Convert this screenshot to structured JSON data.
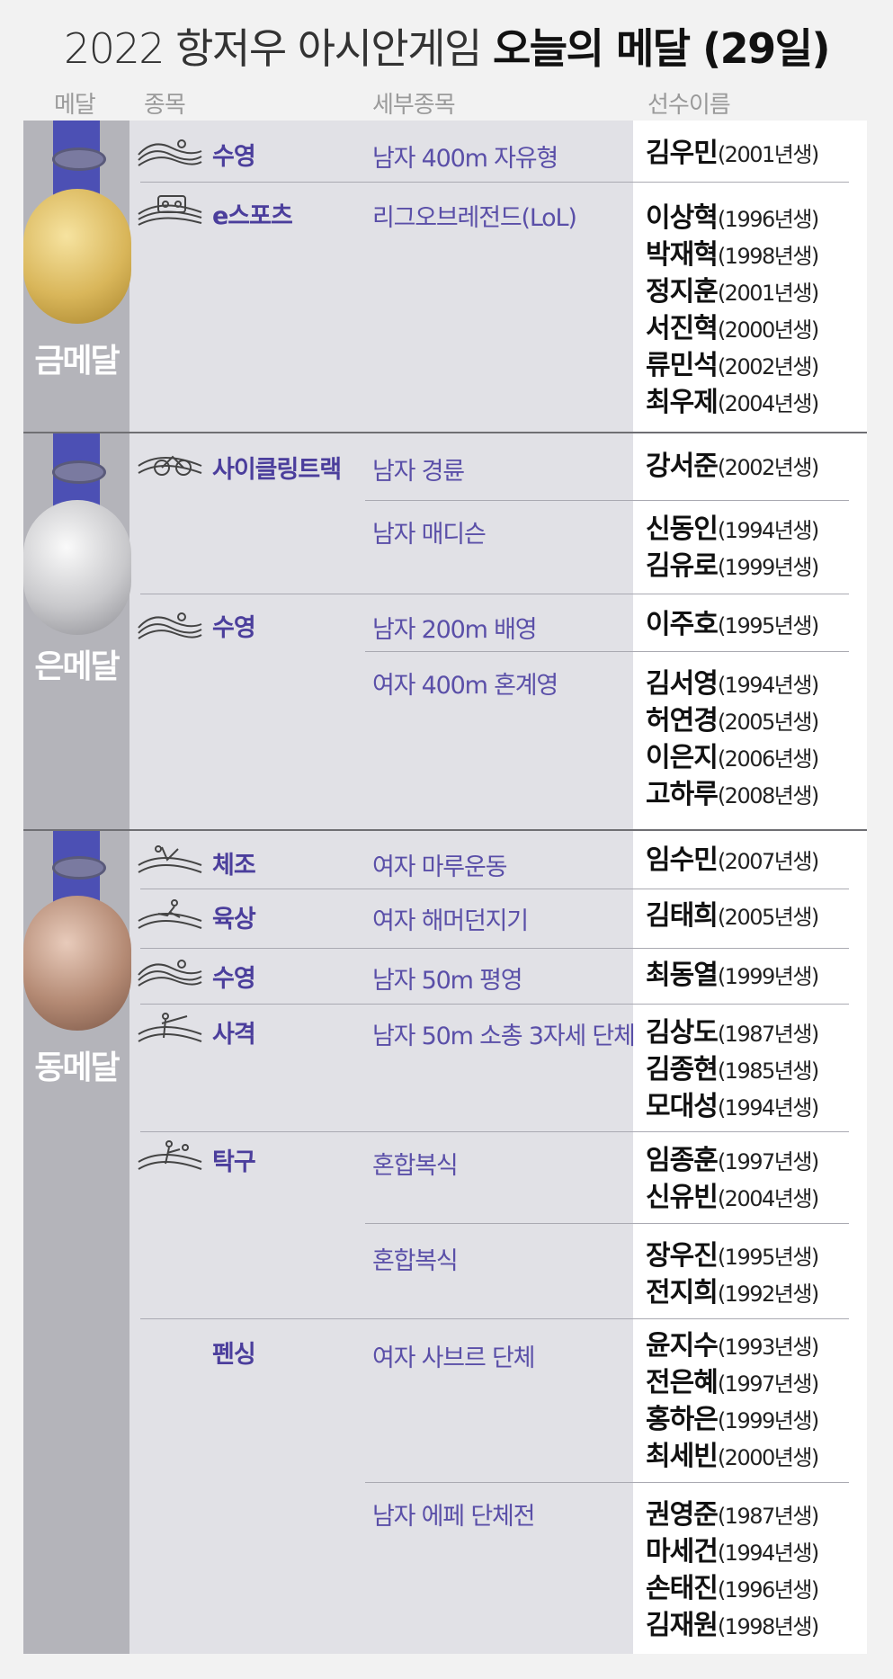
{
  "title": {
    "part1": "2022 항저우 아시안게임",
    "part2": "오늘의 메달 (29일)"
  },
  "headers": {
    "medal": "메달",
    "sport": "종목",
    "event": "세부종목",
    "athlete": "선수이름"
  },
  "colors": {
    "accent": "#4b3e9c",
    "ribbon": "#4c50b4",
    "gold": "#d9b65a",
    "silver": "#c9c9cc",
    "bronze": "#b48a74"
  },
  "medals": {
    "gold": "금메달",
    "silver": "은메달",
    "bronze": "동메달"
  },
  "sports": [
    {
      "name": "수영",
      "icon": "swimming-icon"
    },
    {
      "name": "e스포츠",
      "icon": "esports-icon"
    },
    {
      "name": "사이클링트랙",
      "icon": "cycling-icon"
    },
    {
      "name": "수영",
      "icon": "swimming-icon"
    },
    {
      "name": "체조",
      "icon": "gymnastics-icon"
    },
    {
      "name": "육상",
      "icon": "athletics-icon"
    },
    {
      "name": "수영",
      "icon": "swimming-icon"
    },
    {
      "name": "사격",
      "icon": "shooting-icon"
    },
    {
      "name": "탁구",
      "icon": "table-tennis-icon"
    },
    {
      "name": "펜싱",
      "icon": ""
    }
  ],
  "events": [
    "남자 400m 자유형",
    "리그오브레전드(LoL)",
    "남자 경륜",
    "남자 매디슨",
    "남자 200m 배영",
    "여자 400m 혼계영",
    "여자 마루운동",
    "여자 해머던지기",
    "남자 50m 평영",
    "남자 50m 소총 3자세 단체",
    "혼합복식",
    "혼합복식",
    "여자 사브르 단체",
    "남자 에페 단체전"
  ],
  "athletes": [
    {
      "name": "김우민",
      "year": "(2001년생)"
    },
    {
      "name": "이상혁",
      "year": "(1996년생)"
    },
    {
      "name": "박재혁",
      "year": "(1998년생)"
    },
    {
      "name": "정지훈",
      "year": "(2001년생)"
    },
    {
      "name": "서진혁",
      "year": "(2000년생)"
    },
    {
      "name": "류민석",
      "year": "(2002년생)"
    },
    {
      "name": "최우제",
      "year": "(2004년생)"
    },
    {
      "name": "강서준",
      "year": "(2002년생)"
    },
    {
      "name": "신동인",
      "year": "(1994년생)"
    },
    {
      "name": "김유로",
      "year": "(1999년생)"
    },
    {
      "name": "이주호",
      "year": "(1995년생)"
    },
    {
      "name": "김서영",
      "year": "(1994년생)"
    },
    {
      "name": "허연경",
      "year": "(2005년생)"
    },
    {
      "name": "이은지",
      "year": "(2006년생)"
    },
    {
      "name": "고하루",
      "year": "(2008년생)"
    },
    {
      "name": "임수민",
      "year": "(2007년생)"
    },
    {
      "name": "김태희",
      "year": "(2005년생)"
    },
    {
      "name": "최동열",
      "year": "(1999년생)"
    },
    {
      "name": "김상도",
      "year": "(1987년생)"
    },
    {
      "name": "김종현",
      "year": "(1985년생)"
    },
    {
      "name": "모대성",
      "year": "(1994년생)"
    },
    {
      "name": "임종훈",
      "year": "(1997년생)"
    },
    {
      "name": "신유빈",
      "year": "(2004년생)"
    },
    {
      "name": "장우진",
      "year": "(1995년생)"
    },
    {
      "name": "전지희",
      "year": "(1992년생)"
    },
    {
      "name": "윤지수",
      "year": "(1993년생)"
    },
    {
      "name": "전은혜",
      "year": "(1997년생)"
    },
    {
      "name": "홍하은",
      "year": "(1999년생)"
    },
    {
      "name": "최세빈",
      "year": "(2000년생)"
    },
    {
      "name": "권영준",
      "year": "(1987년생)"
    },
    {
      "name": "마세건",
      "year": "(1994년생)"
    },
    {
      "name": "손태진",
      "year": "(1996년생)"
    },
    {
      "name": "김재원",
      "year": "(1998년생)"
    }
  ]
}
